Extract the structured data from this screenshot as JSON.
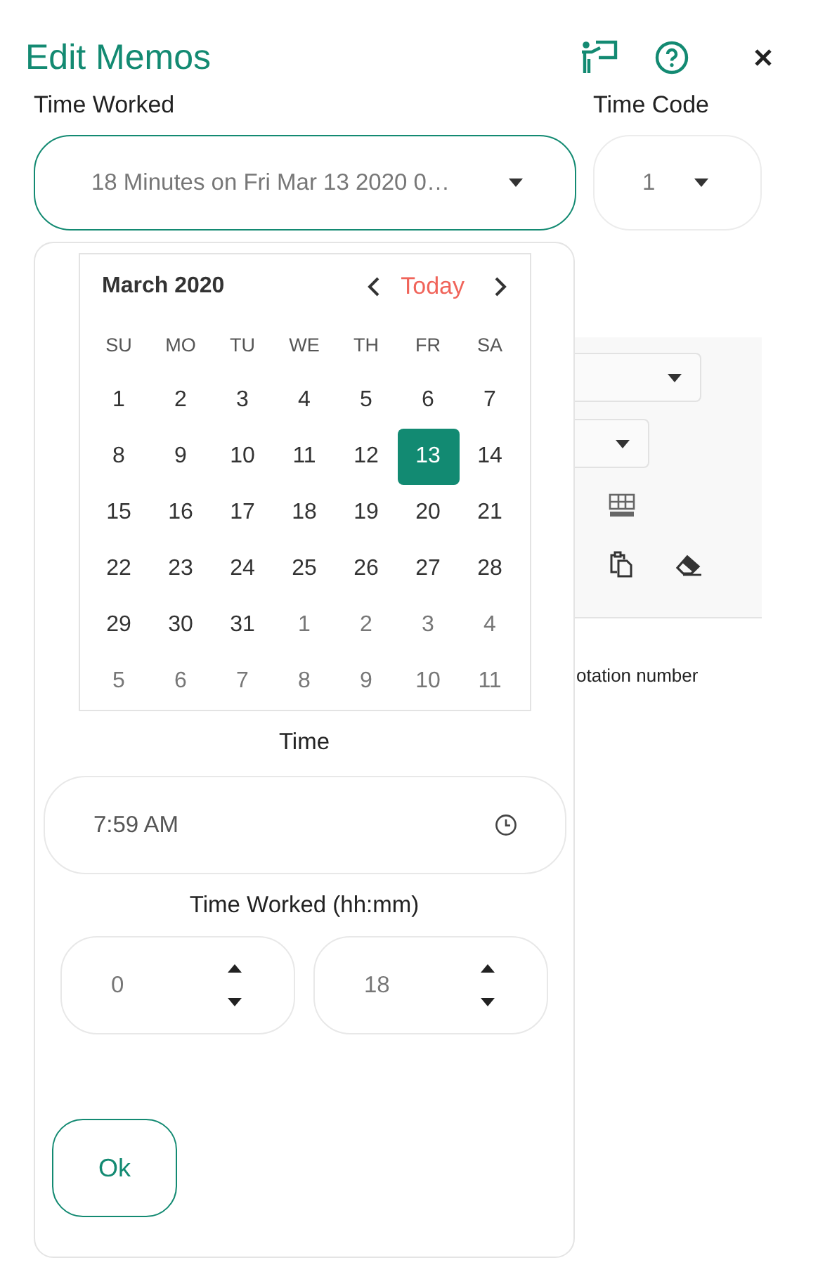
{
  "title": "Edit Memos",
  "fields": {
    "time_worked": {
      "label": "Time Worked",
      "value": "18 Minutes on Fri Mar 13 2020 0…",
      "expanded": true
    },
    "time_code": {
      "label": "Time Code",
      "value": "1"
    }
  },
  "background": {
    "caption": "otation number"
  },
  "calendar": {
    "month": "March 2020",
    "today": "Today",
    "weekdays": [
      "SU",
      "MO",
      "TU",
      "WE",
      "TH",
      "FR",
      "SA"
    ],
    "days": [
      {
        "label": "1",
        "outside": false,
        "selected": false
      },
      {
        "label": "2",
        "outside": false,
        "selected": false
      },
      {
        "label": "3",
        "outside": false,
        "selected": false
      },
      {
        "label": "4",
        "outside": false,
        "selected": false
      },
      {
        "label": "5",
        "outside": false,
        "selected": false
      },
      {
        "label": "6",
        "outside": false,
        "selected": false
      },
      {
        "label": "7",
        "outside": false,
        "selected": false
      },
      {
        "label": "8",
        "outside": false,
        "selected": false
      },
      {
        "label": "9",
        "outside": false,
        "selected": false
      },
      {
        "label": "10",
        "outside": false,
        "selected": false
      },
      {
        "label": "11",
        "outside": false,
        "selected": false
      },
      {
        "label": "12",
        "outside": false,
        "selected": false
      },
      {
        "label": "13",
        "outside": false,
        "selected": true
      },
      {
        "label": "14",
        "outside": false,
        "selected": false
      },
      {
        "label": "15",
        "outside": false,
        "selected": false
      },
      {
        "label": "16",
        "outside": false,
        "selected": false
      },
      {
        "label": "17",
        "outside": false,
        "selected": false
      },
      {
        "label": "18",
        "outside": false,
        "selected": false
      },
      {
        "label": "19",
        "outside": false,
        "selected": false
      },
      {
        "label": "20",
        "outside": false,
        "selected": false
      },
      {
        "label": "21",
        "outside": false,
        "selected": false
      },
      {
        "label": "22",
        "outside": false,
        "selected": false
      },
      {
        "label": "23",
        "outside": false,
        "selected": false
      },
      {
        "label": "24",
        "outside": false,
        "selected": false
      },
      {
        "label": "25",
        "outside": false,
        "selected": false
      },
      {
        "label": "26",
        "outside": false,
        "selected": false
      },
      {
        "label": "27",
        "outside": false,
        "selected": false
      },
      {
        "label": "28",
        "outside": false,
        "selected": false
      },
      {
        "label": "29",
        "outside": false,
        "selected": false
      },
      {
        "label": "30",
        "outside": false,
        "selected": false
      },
      {
        "label": "31",
        "outside": false,
        "selected": false
      },
      {
        "label": "1",
        "outside": true,
        "selected": false
      },
      {
        "label": "2",
        "outside": true,
        "selected": false
      },
      {
        "label": "3",
        "outside": true,
        "selected": false
      },
      {
        "label": "4",
        "outside": true,
        "selected": false
      },
      {
        "label": "5",
        "outside": true,
        "selected": false
      },
      {
        "label": "6",
        "outside": true,
        "selected": false
      },
      {
        "label": "7",
        "outside": true,
        "selected": false
      },
      {
        "label": "8",
        "outside": true,
        "selected": false
      },
      {
        "label": "9",
        "outside": true,
        "selected": false
      },
      {
        "label": "10",
        "outside": true,
        "selected": false
      },
      {
        "label": "11",
        "outside": true,
        "selected": false
      }
    ]
  },
  "time": {
    "label": "Time",
    "value": "7:59 AM"
  },
  "duration": {
    "label": "Time Worked (hh:mm)",
    "hours": "0",
    "minutes": "18"
  },
  "ok": "Ok"
}
